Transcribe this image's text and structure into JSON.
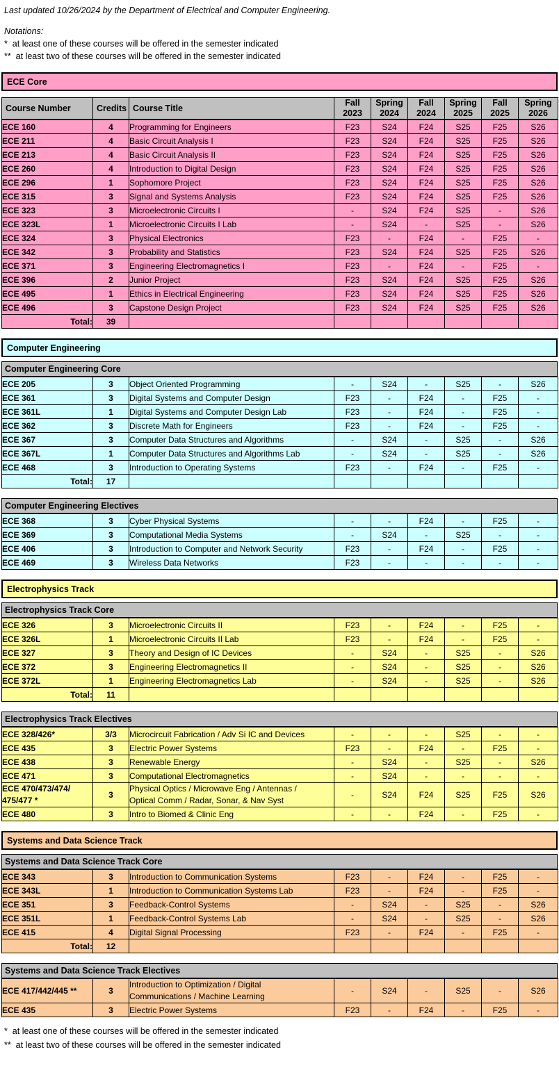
{
  "document": {
    "last_updated_line": "Last updated 10/26/2024 by the Department of Electrical and Computer Engineering.",
    "notations_label": "Notations:",
    "note_single_star": "*  at least one of these courses will be offered in the semester indicated",
    "note_double_star": "**  at least two of these courses will be offered in the semester indicated",
    "footer_single_star": "*  at least one of these courses will be offered in the semester indicated",
    "footer_double_star": "**  at least two of these courses will be offered in the semester indicated"
  },
  "colors": {
    "ece_core": "#ff9ec7",
    "computer_engineering": "#ccffff",
    "electrophysics": "#ffff99",
    "systems_data_science": "#fbcb9c",
    "section_header_gray": "#c0c0c0",
    "border": "#000000"
  },
  "columns": {
    "course_number": "Course Number",
    "credits": "Credits",
    "course_title": "Course Title",
    "semesters": [
      {
        "season": "Fall",
        "year": "2023"
      },
      {
        "season": "Spring",
        "year": "2024"
      },
      {
        "season": "Fall",
        "year": "2024"
      },
      {
        "season": "Spring",
        "year": "2025"
      },
      {
        "season": "Fall",
        "year": "2025"
      },
      {
        "season": "Spring",
        "year": "2026"
      }
    ]
  },
  "total_label": "Total:",
  "sections": [
    {
      "banner": "ECE Core",
      "color_key": "ece_core",
      "has_column_header": true,
      "subsections": [
        {
          "title": null,
          "rows": [
            {
              "number": "ECE 160",
              "credits": "4",
              "title": "Programming for Engineers",
              "offered": [
                "F23",
                "S24",
                "F24",
                "S25",
                "F25",
                "S26"
              ]
            },
            {
              "number": "ECE 211",
              "credits": "4",
              "title": "Basic Circuit Analysis I",
              "offered": [
                "F23",
                "S24",
                "F24",
                "S25",
                "F25",
                "S26"
              ]
            },
            {
              "number": "ECE 213",
              "credits": "4",
              "title": "Basic Circuit Analysis II",
              "offered": [
                "F23",
                "S24",
                "F24",
                "S25",
                "F25",
                "S26"
              ]
            },
            {
              "number": "ECE 260",
              "credits": "4",
              "title": "Introduction to Digital Design",
              "offered": [
                "F23",
                "S24",
                "F24",
                "S25",
                "F25",
                "S26"
              ]
            },
            {
              "number": "ECE 296",
              "credits": "1",
              "title": "Sophomore Project",
              "offered": [
                "F23",
                "S24",
                "F24",
                "S25",
                "F25",
                "S26"
              ]
            },
            {
              "number": "ECE 315",
              "credits": "3",
              "title": "Signal and Systems Analysis",
              "offered": [
                "F23",
                "S24",
                "F24",
                "S25",
                "F25",
                "S26"
              ]
            },
            {
              "number": "ECE 323",
              "credits": "3",
              "title": "Microelectronic Circuits I",
              "offered": [
                "-",
                "S24",
                "F24",
                "S25",
                "-",
                "S26"
              ]
            },
            {
              "number": "ECE 323L",
              "credits": "1",
              "title": "Microelectronic Circuits I Lab",
              "offered": [
                "-",
                "S24",
                "-",
                "S25",
                "-",
                "S26"
              ]
            },
            {
              "number": "ECE 324",
              "credits": "3",
              "title": "Physical Electronics",
              "offered": [
                "F23",
                "-",
                "F24",
                "-",
                "F25",
                "-"
              ]
            },
            {
              "number": "ECE 342",
              "credits": "3",
              "title": "Probability and Statistics",
              "offered": [
                "F23",
                "S24",
                "F24",
                "S25",
                "F25",
                "S26"
              ]
            },
            {
              "number": "ECE 371",
              "credits": "3",
              "title": "Engineering Electromagnetics I",
              "offered": [
                "F23",
                "-",
                "F24",
                "-",
                "F25",
                "-"
              ]
            },
            {
              "number": "ECE 396",
              "credits": "2",
              "title": "Junior Project",
              "offered": [
                "F23",
                "S24",
                "F24",
                "S25",
                "F25",
                "S26"
              ]
            },
            {
              "number": "ECE 495",
              "credits": "1",
              "title": "Ethics in Electrical Engineering",
              "offered": [
                "F23",
                "S24",
                "F24",
                "S25",
                "F25",
                "S26"
              ]
            },
            {
              "number": "ECE 496",
              "credits": "3",
              "title": "Capstone Design Project",
              "offered": [
                "F23",
                "S24",
                "F24",
                "S25",
                "F25",
                "S26"
              ]
            }
          ],
          "total": "39"
        }
      ]
    },
    {
      "banner": "Computer Engineering",
      "color_key": "computer_engineering",
      "has_column_header": false,
      "subsections": [
        {
          "title": "Computer Engineering Core",
          "rows": [
            {
              "number": "ECE 205",
              "credits": "3",
              "title": "Object Oriented Programming",
              "offered": [
                "-",
                "S24",
                "-",
                "S25",
                "-",
                "S26"
              ]
            },
            {
              "number": "ECE 361",
              "credits": "3",
              "title": "Digital Systems and Computer Design",
              "offered": [
                "F23",
                "-",
                "F24",
                "-",
                "F25",
                "-"
              ]
            },
            {
              "number": "ECE 361L",
              "credits": "1",
              "title": "Digital Systems and Computer Design Lab",
              "offered": [
                "F23",
                "-",
                "F24",
                "-",
                "F25",
                "-"
              ]
            },
            {
              "number": "ECE 362",
              "credits": "3",
              "title": "Discrete Math for Engineers",
              "offered": [
                "F23",
                "-",
                "F24",
                "-",
                "F25",
                "-"
              ]
            },
            {
              "number": "ECE 367",
              "credits": "3",
              "title": "Computer Data Structures and Algorithms",
              "offered": [
                "-",
                "S24",
                "-",
                "S25",
                "-",
                "S26"
              ]
            },
            {
              "number": "ECE 367L",
              "credits": "1",
              "title": "Computer Data Structures and Algorithms Lab",
              "offered": [
                "-",
                "S24",
                "-",
                "S25",
                "-",
                "S26"
              ]
            },
            {
              "number": "ECE 468",
              "credits": "3",
              "title": "Introduction to Operating Systems",
              "offered": [
                "F23",
                "-",
                "F24",
                "-",
                "F25",
                "-"
              ]
            }
          ],
          "total": "17"
        },
        {
          "title": "Computer Engineering Electives",
          "rows": [
            {
              "number": "ECE 368",
              "credits": "3",
              "title": "Cyber Physical Systems",
              "offered": [
                "-",
                "-",
                "F24",
                "-",
                "F25",
                "-"
              ]
            },
            {
              "number": "ECE 369",
              "credits": "3",
              "title": "Computational Media Systems",
              "offered": [
                "-",
                "S24",
                "-",
                "S25",
                "-",
                "-"
              ]
            },
            {
              "number": "ECE 406",
              "credits": "3",
              "title": "Introduction to Computer and Network Security",
              "offered": [
                "F23",
                "-",
                "F24",
                "-",
                "F25",
                "-"
              ]
            },
            {
              "number": "ECE 469",
              "credits": "3",
              "title": "Wireless Data Networks",
              "offered": [
                "F23",
                "-",
                "-",
                "-",
                "-",
                "-"
              ]
            }
          ],
          "total": null
        }
      ]
    },
    {
      "banner": "Electrophysics Track",
      "color_key": "electrophysics",
      "has_column_header": false,
      "subsections": [
        {
          "title": "Electrophysics Track Core",
          "rows": [
            {
              "number": "ECE 326",
              "credits": "3",
              "title": "Microelectronic Circuits II",
              "offered": [
                "F23",
                "-",
                "F24",
                "-",
                "F25",
                "-"
              ]
            },
            {
              "number": "ECE 326L",
              "credits": "1",
              "title": "Microelectronic Circuits II Lab",
              "offered": [
                "F23",
                "-",
                "F24",
                "-",
                "F25",
                "-"
              ]
            },
            {
              "number": "ECE 327",
              "credits": "3",
              "title": "Theory and Design of IC Devices",
              "offered": [
                "-",
                "S24",
                "-",
                "S25",
                "-",
                "S26"
              ]
            },
            {
              "number": "ECE 372",
              "credits": "3",
              "title": "Engineering Electromagnetics II",
              "offered": [
                "-",
                "S24",
                "-",
                "S25",
                "-",
                "S26"
              ]
            },
            {
              "number": "ECE 372L",
              "credits": "1",
              "title": "Engineering Electromagnetics Lab",
              "offered": [
                "-",
                "S24",
                "-",
                "S25",
                "-",
                "S26"
              ]
            }
          ],
          "total": "11"
        },
        {
          "title": "Electrophysics Track Electives",
          "rows": [
            {
              "number": "ECE 328/426*",
              "credits": "3/3",
              "title": "Microcircuit Fabrication / Adv Si IC and Devices",
              "offered": [
                "-",
                "-",
                "-",
                "S25",
                "-",
                "-"
              ]
            },
            {
              "number": "ECE 435",
              "credits": "3",
              "title": "Electric Power Systems",
              "offered": [
                "F23",
                "-",
                "F24",
                "-",
                "F25",
                "-"
              ]
            },
            {
              "number": "ECE 438",
              "credits": "3",
              "title": "Renewable Energy",
              "offered": [
                "-",
                "S24",
                "-",
                "S25",
                "-",
                "S26"
              ]
            },
            {
              "number": "ECE 471",
              "credits": "3",
              "title": "Computational Electromagnetics",
              "offered": [
                "-",
                "S24",
                "-",
                "-",
                "-",
                "-"
              ]
            },
            {
              "number": "ECE 470/473/474/ 475/477 *",
              "number_line1": "ECE 470/473/474/",
              "number_line2": "475/477 *",
              "credits": "3",
              "title_line1": "Physical Optics / Microwave Eng / Antennas /",
              "title_line2": "Optical Comm / Radar, Sonar, & Nav Syst",
              "title": "Physical Optics / Microwave Eng / Antennas / Optical Comm / Radar, Sonar, & Nav Syst",
              "tall": true,
              "offered": [
                "-",
                "S24",
                "F24",
                "S25",
                "F25",
                "S26"
              ]
            },
            {
              "number": "ECE 480",
              "credits": "3",
              "title": "Intro to Biomed & Clinic Eng",
              "offered": [
                "-",
                "-",
                "F24",
                "-",
                "F25",
                "-"
              ]
            }
          ],
          "total": null
        }
      ]
    },
    {
      "banner": "Systems and Data Science Track",
      "color_key": "systems_data_science",
      "has_column_header": false,
      "subsections": [
        {
          "title": "Systems and Data Science Track Core",
          "rows": [
            {
              "number": "ECE 343",
              "credits": "3",
              "title": "Introduction to Communication Systems",
              "offered": [
                "F23",
                "-",
                "F24",
                "-",
                "F25",
                "-"
              ]
            },
            {
              "number": "ECE 343L",
              "credits": "1",
              "title": "Introduction to Communication Systems Lab",
              "offered": [
                "F23",
                "-",
                "F24",
                "-",
                "F25",
                "-"
              ]
            },
            {
              "number": "ECE 351",
              "credits": "3",
              "title": "Feedback-Control Systems",
              "offered": [
                "-",
                "S24",
                "-",
                "S25",
                "-",
                "S26"
              ]
            },
            {
              "number": "ECE 351L",
              "credits": "1",
              "title": "Feedback-Control Systems Lab",
              "offered": [
                "-",
                "S24",
                "-",
                "S25",
                "-",
                "S26"
              ]
            },
            {
              "number": "ECE 415",
              "credits": "4",
              "title": "Digital Signal Processing",
              "offered": [
                "F23",
                "-",
                "F24",
                "-",
                "F25",
                "-"
              ]
            }
          ],
          "total": "12"
        },
        {
          "title": "Systems and Data Science Track Electives",
          "rows": [
            {
              "number": "ECE 417/442/445 **",
              "credits": "3",
              "title_line1": "Introduction to Optimization / Digital",
              "title_line2": "Communications / Machine Learning",
              "title": "Introduction to Optimization / Digital Communications / Machine Learning",
              "tall": true,
              "offered": [
                "-",
                "S24",
                "-",
                "S25",
                "-",
                "S26"
              ]
            },
            {
              "number": "ECE 435",
              "credits": "3",
              "title": "Electric Power Systems",
              "offered": [
                "F23",
                "-",
                "F24",
                "-",
                "F25",
                "-"
              ]
            }
          ],
          "total": null
        }
      ]
    }
  ]
}
